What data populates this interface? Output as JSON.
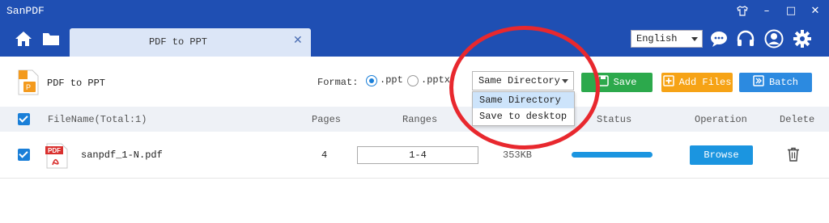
{
  "app": {
    "title": "SanPDF"
  },
  "window_controls": {
    "theme_icon": "shirt-icon",
    "minimize": "–",
    "maximize": "□",
    "close": "✕"
  },
  "nav": {
    "home_icon": "home-icon",
    "folder_icon": "folder-icon"
  },
  "tab": {
    "label": "PDF to PPT",
    "close": "✕"
  },
  "header": {
    "language": "English",
    "chat_icon": "chat-icon",
    "support_icon": "headphones-icon",
    "account_icon": "user-icon",
    "settings_icon": "gear-icon"
  },
  "toolbar": {
    "tool_name": "PDF to PPT",
    "format_label": "Format:",
    "format_options": [
      ".ppt",
      ".pptx"
    ],
    "format_selected": ".ppt",
    "output_dir": "Same Directory",
    "save_label": "Save",
    "add_files_label": "Add Files",
    "batch_label": "Batch"
  },
  "dropdown": {
    "options": [
      "Same Directory",
      "Save to desktop"
    ],
    "selected": "Same Directory"
  },
  "table": {
    "columns": {
      "filename": "FileName(Total:1)",
      "pages": "Pages",
      "ranges": "Ranges",
      "status": "Status",
      "operation": "Operation",
      "delete": "Delete"
    },
    "rows": [
      {
        "name": "sanpdf_1-N.pdf",
        "pages": "4",
        "range": "1-4",
        "size": "353KB",
        "progress": 1.0,
        "action": "Browse"
      }
    ]
  },
  "colors": {
    "titlebar": "#1f4fb3",
    "save": "#2ca94c",
    "add": "#f6a316",
    "batch": "#2c8ae0",
    "accent": "#1b95e0",
    "annotation": "#e8282e"
  }
}
